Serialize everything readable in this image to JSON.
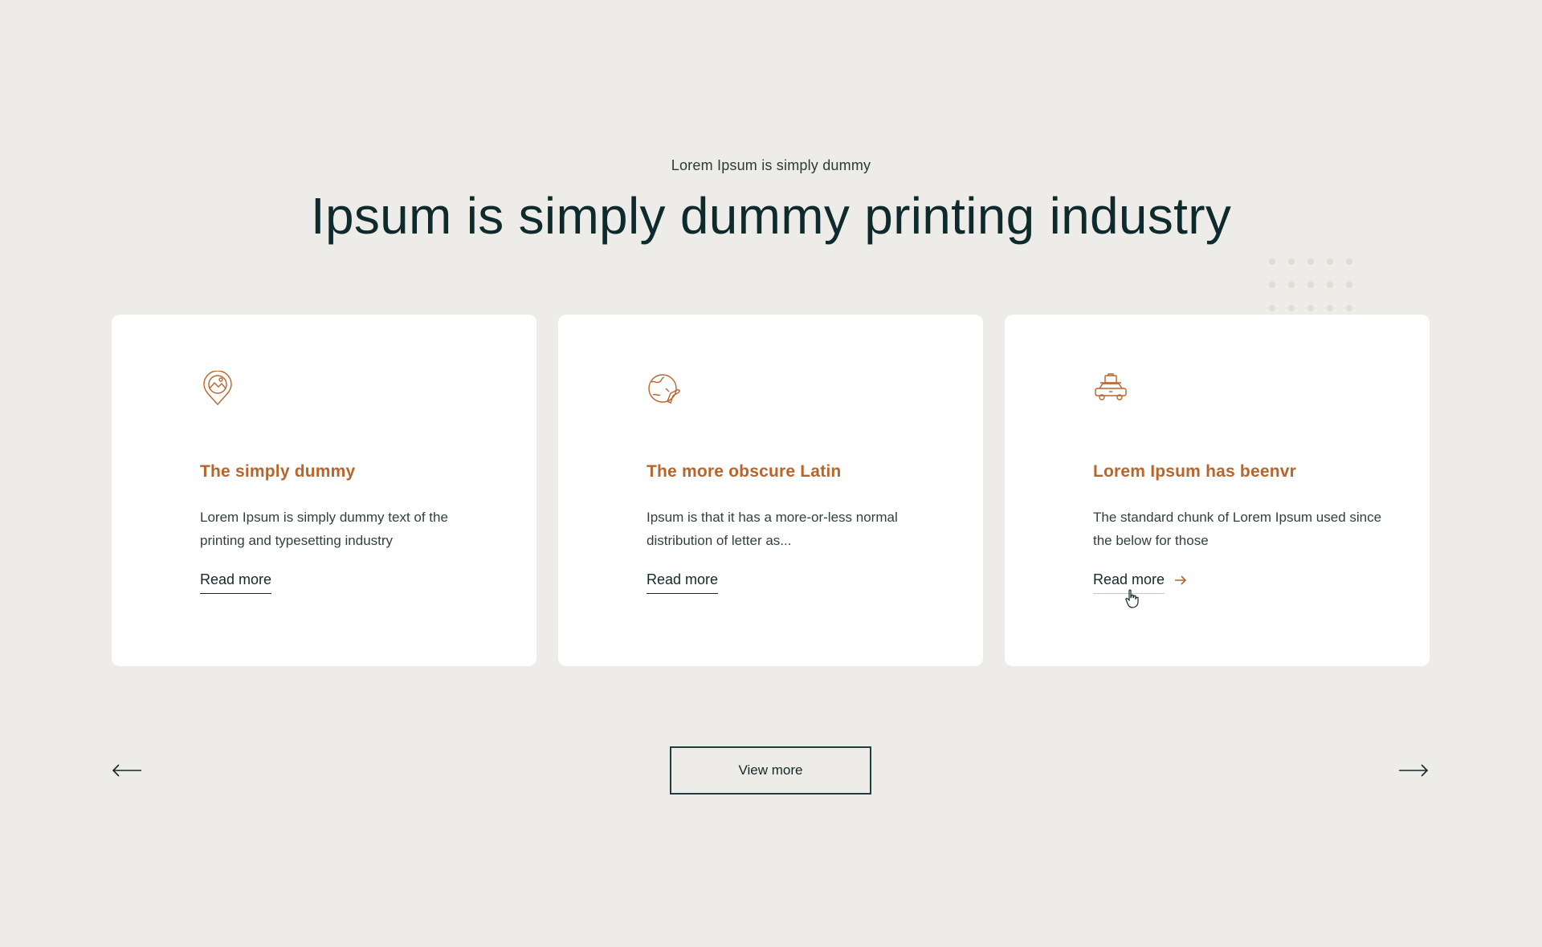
{
  "section": {
    "eyebrow": "Lorem Ipsum is simply dummy",
    "headline": "Ipsum is simply dummy printing industry"
  },
  "cards": [
    {
      "icon": "location-pin-landscape-icon",
      "title": "The simply dummy",
      "description": "Lorem Ipsum is simply dummy text of the printing and typesetting industry",
      "link_label": "Read more"
    },
    {
      "icon": "globe-airplane-icon",
      "title": "The more obscure Latin",
      "description": "Ipsum is that it has a more-or-less normal distribution of letter as...",
      "link_label": "Read more"
    },
    {
      "icon": "car-luggage-icon",
      "title": "Lorem Ipsum has beenvr",
      "description": "The standard chunk of Lorem Ipsum used since the below for those",
      "link_label": "Read more"
    }
  ],
  "controls": {
    "view_more_label": "View more",
    "prev_icon": "arrow-left-icon",
    "next_icon": "arrow-right-icon"
  },
  "colors": {
    "background": "#eeece8",
    "card": "#ffffff",
    "accent": "#b9642b",
    "text_dark": "#0f2a2c"
  }
}
